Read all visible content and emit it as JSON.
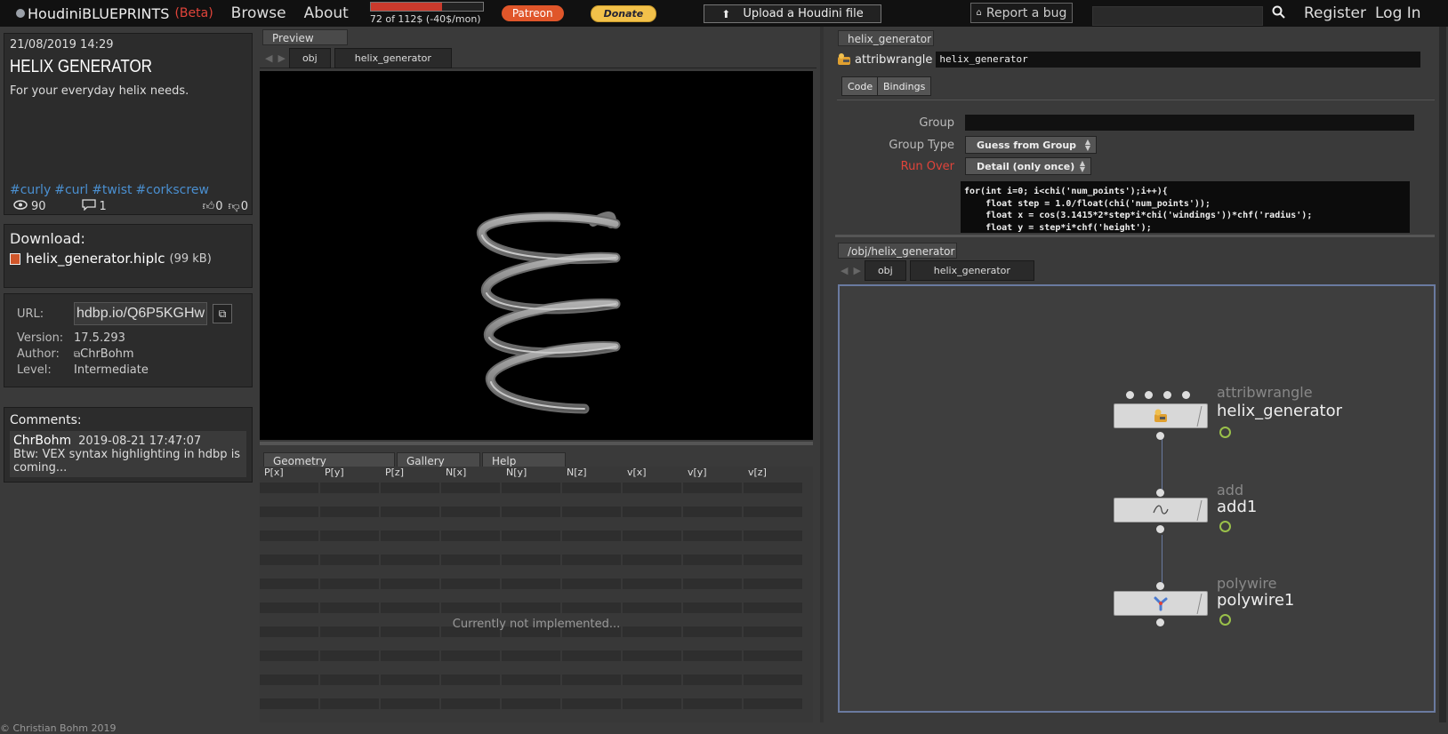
{
  "topbar": {
    "brand_prefix": "Houdini",
    "brand_main": "BLUEPRINTS",
    "brand_beta": "(Beta)",
    "browse": "Browse",
    "about": "About",
    "funding_text": "72 of 112$ (-40$/mon)",
    "funding_progress": 0.64,
    "patreon": "Patreon",
    "donate": "Donate",
    "upload": "Upload a Houdini file",
    "report_bug": "Report a bug",
    "search_placeholder": "",
    "register": "Register",
    "login": "Log In"
  },
  "info": {
    "date": "21/08/2019 14:29",
    "title": "HELIX GENERATOR",
    "description": "For your everyday helix needs.",
    "tags": [
      "#curly",
      "#curl",
      "#twist",
      "#corkscrew"
    ],
    "views": "90",
    "comments": "1",
    "likes": "0",
    "dislikes": "0"
  },
  "download": {
    "heading": "Download:",
    "filename": "helix_generator.hiplc",
    "size": "(99 kB)"
  },
  "meta": {
    "url_label": "URL:",
    "url_value": "hdbp.io/Q6P5KGHw",
    "version_label": "Version:",
    "version_value": "17.5.293",
    "author_label": "Author:",
    "author_value": "ChrBohm",
    "level_label": "Level:",
    "level_value": "Intermediate"
  },
  "comments": {
    "heading": "Comments:",
    "items": [
      {
        "author": "ChrBohm",
        "time": "2019-08-21 17:47:07",
        "text": "Btw: VEX syntax highlighting in hdbp is coming..."
      }
    ]
  },
  "footer": "© Christian Bohm 2019",
  "preview": {
    "tab": "Preview",
    "crumbs": [
      "obj",
      "helix_generator"
    ]
  },
  "bottom_tabs": [
    "Geometry Spreadsheet",
    "Gallery",
    "Help"
  ],
  "spreadsheet": {
    "columns": [
      "P[x]",
      "P[y]",
      "P[z]",
      "N[x]",
      "N[y]",
      "N[z]",
      "v[x]",
      "v[y]",
      "v[z]"
    ],
    "message": "Currently not implemented..."
  },
  "params": {
    "tab": "helix_generator",
    "node_type": "attribwrangle",
    "node_name": "helix_generator",
    "subtabs": [
      "Code",
      "Bindings"
    ],
    "group_label": "Group",
    "group_value": "",
    "group_type_label": "Group Type",
    "group_type_value": "Guess from Group",
    "run_over_label": "Run Over",
    "run_over_value": "Detail (only once)",
    "code": "for(int i=0; i<chi('num_points');i++){\n    float step = 1.0/float(chi('num_points'));\n    float x = cos(3.1415*2*step*i*chi('windings'))*chf('radius');\n    float y = step*i*chf('height');"
  },
  "network": {
    "tab": "/obj/helix_generator",
    "crumbs": [
      "obj",
      "helix_generator"
    ],
    "nodes": [
      {
        "type": "attribwrangle",
        "name": "helix_generator",
        "icon": "wrangle-icon"
      },
      {
        "type": "add",
        "name": "add1",
        "icon": "curve-icon"
      },
      {
        "type": "polywire",
        "name": "polywire1",
        "icon": "polywire-icon"
      }
    ]
  },
  "colors": {
    "accent_red": "#e0443a",
    "tag_blue": "#4a8fd0",
    "patreon": "#e0562a",
    "network_border": "#6a7aa0"
  }
}
